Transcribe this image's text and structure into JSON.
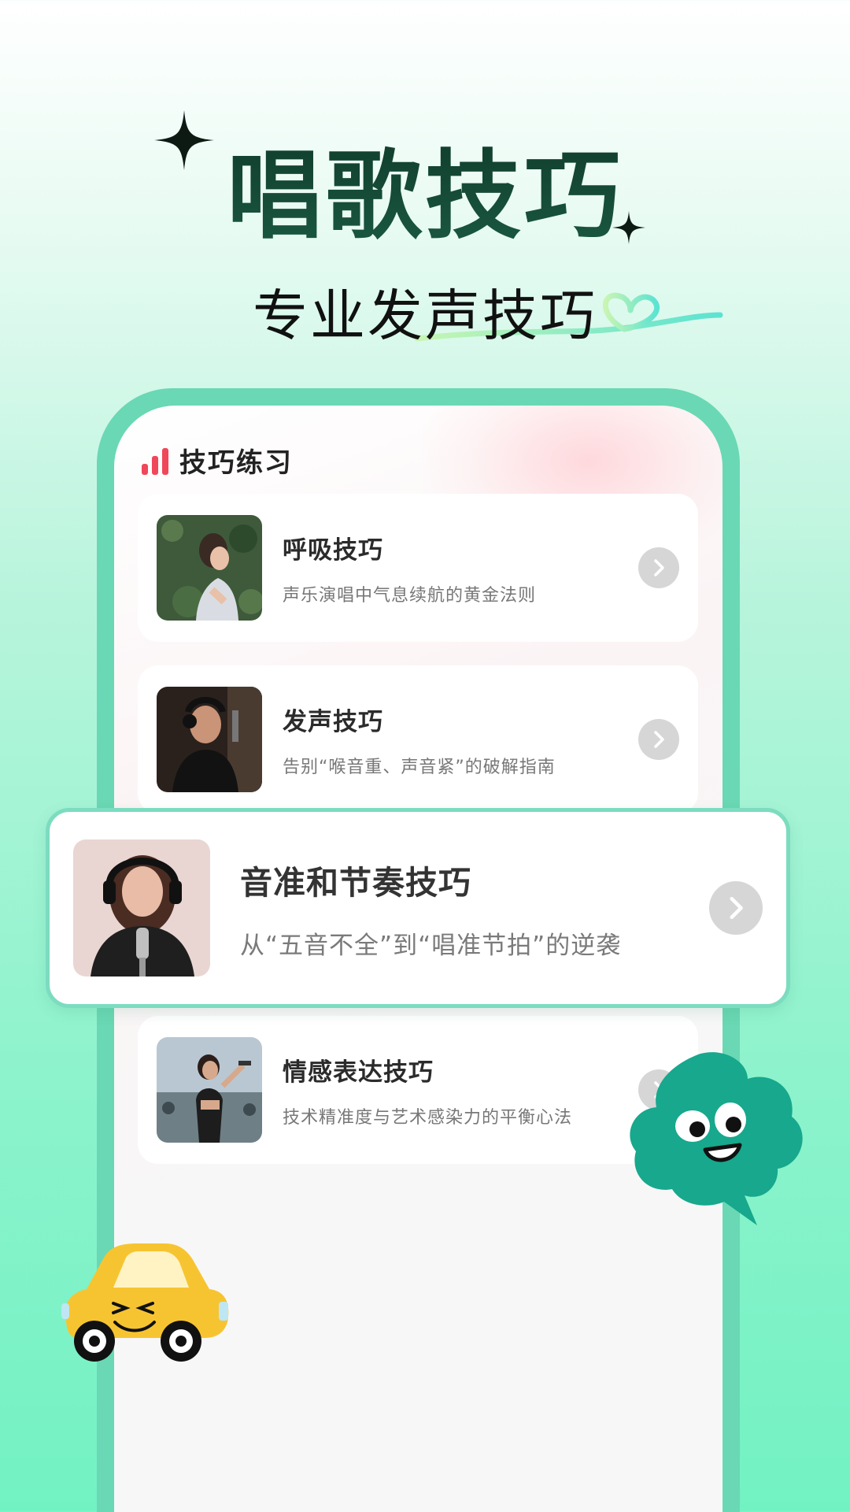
{
  "hero": {
    "title": "唱歌技巧",
    "subtitle": "专业发声技巧"
  },
  "section": {
    "title": "技巧练习",
    "icon": "signal-bars-icon"
  },
  "items": [
    {
      "title": "呼吸技巧",
      "desc": "声乐演唱中气息续航的黄金法则"
    },
    {
      "title": "发声技巧",
      "desc": "告别“喉音重、声音紧”的破解指南"
    },
    {
      "title": "音准和节奏技巧",
      "desc": "从“五音不全”到“唱准节拍”的逆袭"
    },
    {
      "title": "情感表达技巧",
      "desc": "技术精准度与艺术感染力的平衡心法"
    }
  ],
  "colors": {
    "accent": "#6ad8b4",
    "title_dark_green": "#14432f",
    "bar_red": "#f0475a",
    "mascot_green": "#17a88d",
    "car_yellow": "#f7c431"
  }
}
